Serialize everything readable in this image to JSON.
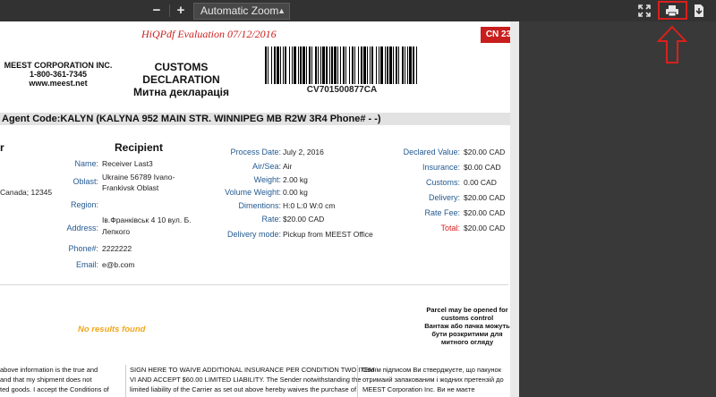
{
  "toolbar": {
    "zoom_out_label": "−",
    "zoom_in_label": "+",
    "zoom_select_value": "Automatic Zoom",
    "icons": [
      "fullscreen-icon",
      "print-icon",
      "download-icon"
    ]
  },
  "document": {
    "evaluation_watermark": "HiQPdf Evaluation 07/12/2016",
    "cn_badge": "CN 23",
    "company": {
      "name": "MEEST CORPORATION INC.",
      "phone": "1-800-361-7345",
      "website": "www.meest.net"
    },
    "title_en": "CUSTOMS DECLARATION",
    "title_uk": "Митна декларація",
    "tracking_number": "CV701500877CA",
    "agent_line": "Agent Code:KALYN (KALYNA 952 MAIN STR. WINNIPEG MB R2W 3R4 Phone# - -)",
    "sender_heading_fragment": "r",
    "sender_fragment": "Canada; 12345",
    "recipient": {
      "heading": "Recipient",
      "name_label": "Name:",
      "name": "Receiver Last3",
      "oblast_label": "Oblast:",
      "oblast_line1": "Ukraine 56789 Ivano-",
      "oblast_line2": "Frankivsk Oblast",
      "region_label": "Region:",
      "address_label": "Address:",
      "address_line1": "Ів.Франківськ 4 10 вул. Б.",
      "address_line2": "Лепкого",
      "phone_label": "Phone#:",
      "phone": "2222222",
      "email_label": "Email:",
      "email": "e@b.com"
    },
    "process": {
      "date_label": "Process Date:",
      "date": "July 2, 2016",
      "airsea_label": "Air/Sea:",
      "airsea": "Air",
      "weight_label": "Weight:",
      "weight": "2.00 kg",
      "volweight_label": "Volume Weight:",
      "volweight": "0.00 kg",
      "dimensions_label": "Dimentions:",
      "dimensions": "H:0 L:0 W:0 cm",
      "rate_label": "Rate:",
      "rate": "$20.00 CAD",
      "delivery_mode_label": "Delivery mode:",
      "delivery_mode": "Pickup from MEEST Office"
    },
    "charges": {
      "declared_label": "Declared Value:",
      "declared": "$20.00 CAD",
      "insurance_label": "Insurance:",
      "insurance": "$0.00 CAD",
      "customs_label": "Customs:",
      "customs": "0.00 CAD",
      "delivery_label": "Delivery:",
      "delivery": "$20.00 CAD",
      "ratefee_label": "Rate Fee:",
      "ratefee": "$20.00 CAD",
      "total_label": "Total:",
      "total": "$20.00 CAD"
    },
    "no_results": "No results found",
    "parcel_note_en1": "Parcel may be opened for",
    "parcel_note_en2": "customs control",
    "parcel_note_uk1": "Вантаж або пачка можуть",
    "parcel_note_uk2": "бути розкритими для",
    "parcel_note_uk3": "митного огляду",
    "footer_left": [
      "above information is the true and",
      "and that my shipment does not",
      "ted goods. I accept the Conditions of"
    ],
    "footer_mid": [
      "SIGN HERE TO WAIVE ADDITIONAL INSURANCE PER CONDITION TWO ITEM",
      "VI AND ACCEPT $60.00 LIMITED LIABILITY. The Sender notwithstanding the",
      "limited liability of the Carrier as set out above hereby waives the purchase of"
    ],
    "footer_right": [
      "Своїм підписом Ви стверджуєте, що пакунок",
      "отримаий запакованим і жодних претензій до",
      "MEEST Corporation Inc. Ви не маєте"
    ]
  },
  "colors": {
    "label_blue": "#245a91",
    "accent_red": "#d9201c",
    "watermark_red": "#cc1f1f",
    "no_results_orange": "#f2a51c"
  }
}
